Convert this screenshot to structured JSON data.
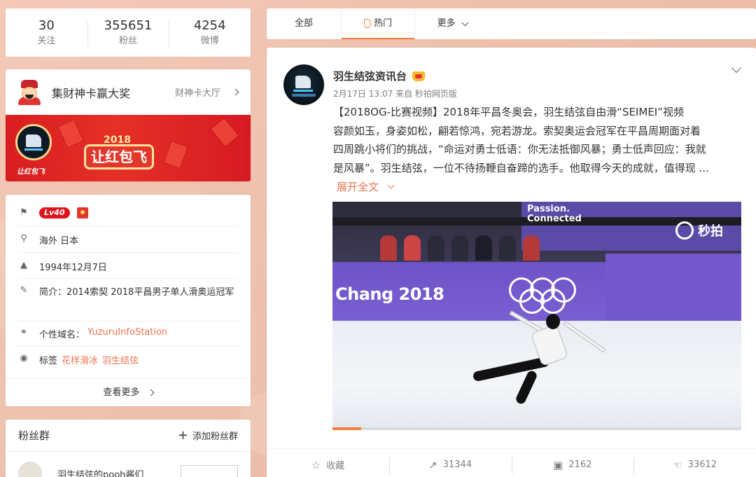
{
  "counters": [
    {
      "value": "30",
      "label": "关注"
    },
    {
      "value": "355651",
      "label": "粉丝"
    },
    {
      "value": "4254",
      "label": "微博"
    }
  ],
  "promo": {
    "title": "集财神卡赢大奖",
    "link": "财神卡大厅",
    "banner_year": "2018",
    "banner_logo": "让红包飞",
    "banner_brand": "让红包飞"
  },
  "profile": {
    "level": "Lv40",
    "location": "海外 日本",
    "birthday": "1994年12月7日",
    "intro_label": "简介：",
    "intro": "2014索契 2018平昌男子单人滑奥运冠军",
    "domain_label": "个性域名：",
    "domain": "YuzuruInfoStation",
    "tags_label": "标签",
    "tags": [
      "花样滑冰",
      "羽生结弦"
    ],
    "more": "查看更多"
  },
  "fans": {
    "title": "粉丝群",
    "add": "添加粉丝群",
    "first_group": "羽生结弦的pooh酱们"
  },
  "tabs": [
    {
      "label": "全部"
    },
    {
      "label": "热门"
    },
    {
      "label": "更多"
    }
  ],
  "post": {
    "author": "羽生结弦资讯台",
    "meta": "2月17日 13:07 来自 秒拍网页版",
    "text_lines": [
      "【2018OG-比赛视频】2018年平昌冬奥会，羽生结弦自由滑“SEIMEI”视频",
      "容颜如玉，身姿如松，翩若惊鸿，宛若游龙。索契奥运会冠军在平昌周期面对着",
      "四周跳小将们的挑战，“命运对勇士低语：你无法抵御风暴；勇士低声回应：我就",
      "是风暴”。羽生结弦，一位不待扬鞭自奋蹄的选手。他取得今天的成就，值得现 ..."
    ],
    "expand": "展开全文",
    "video": {
      "board_text_1": "Passion.",
      "board_text_2": "Connected",
      "watermark": "秒拍",
      "venue_text": "Chang 2018",
      "progress": 0.07
    },
    "actions": [
      {
        "icon": "star-icon",
        "label": "收藏"
      },
      {
        "icon": "share-icon",
        "label": "31344"
      },
      {
        "icon": "comment-icon",
        "label": "2162"
      },
      {
        "icon": "like-icon",
        "label": "33612"
      }
    ]
  },
  "colors": {
    "accent": "#fa7d3c",
    "link": "#eb7350",
    "level_badge": "#e0141e"
  }
}
